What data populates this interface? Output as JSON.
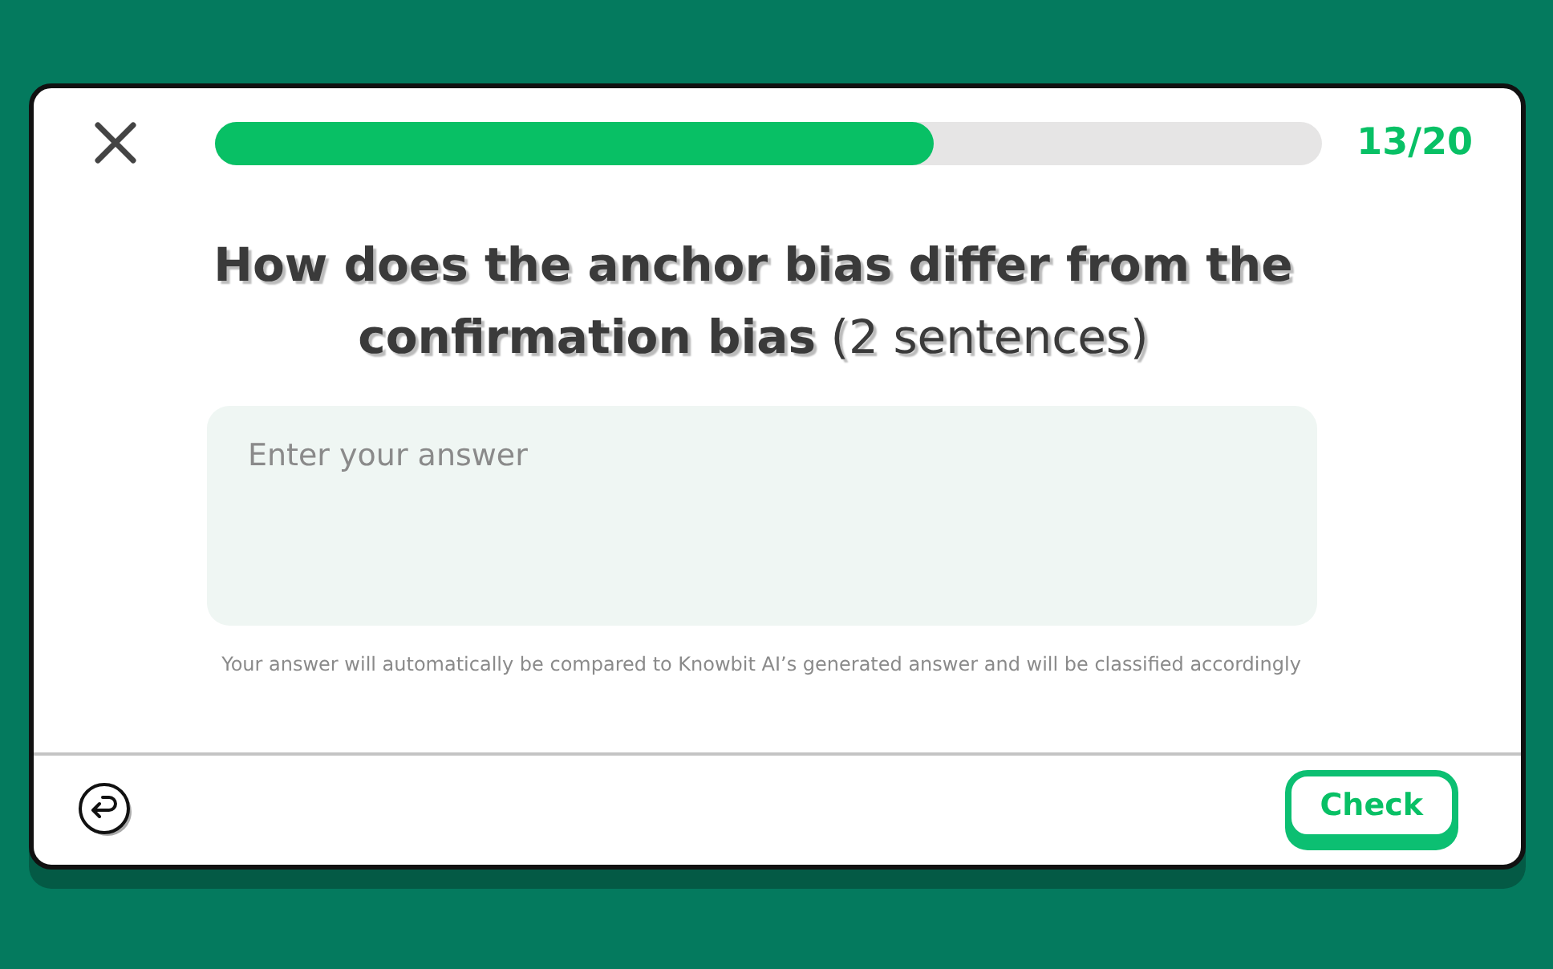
{
  "progress": {
    "level": 0.65,
    "counter": "13/20"
  },
  "question": "**How does the anchor bias differ from the confirmation bias** (2 sentences)",
  "answer": {
    "placeholder": "Enter your answer"
  },
  "note": "Your answer will automatically be compared to Knowbit AI’s generated answer and will be classified accordingly",
  "check_button": "Check"
}
